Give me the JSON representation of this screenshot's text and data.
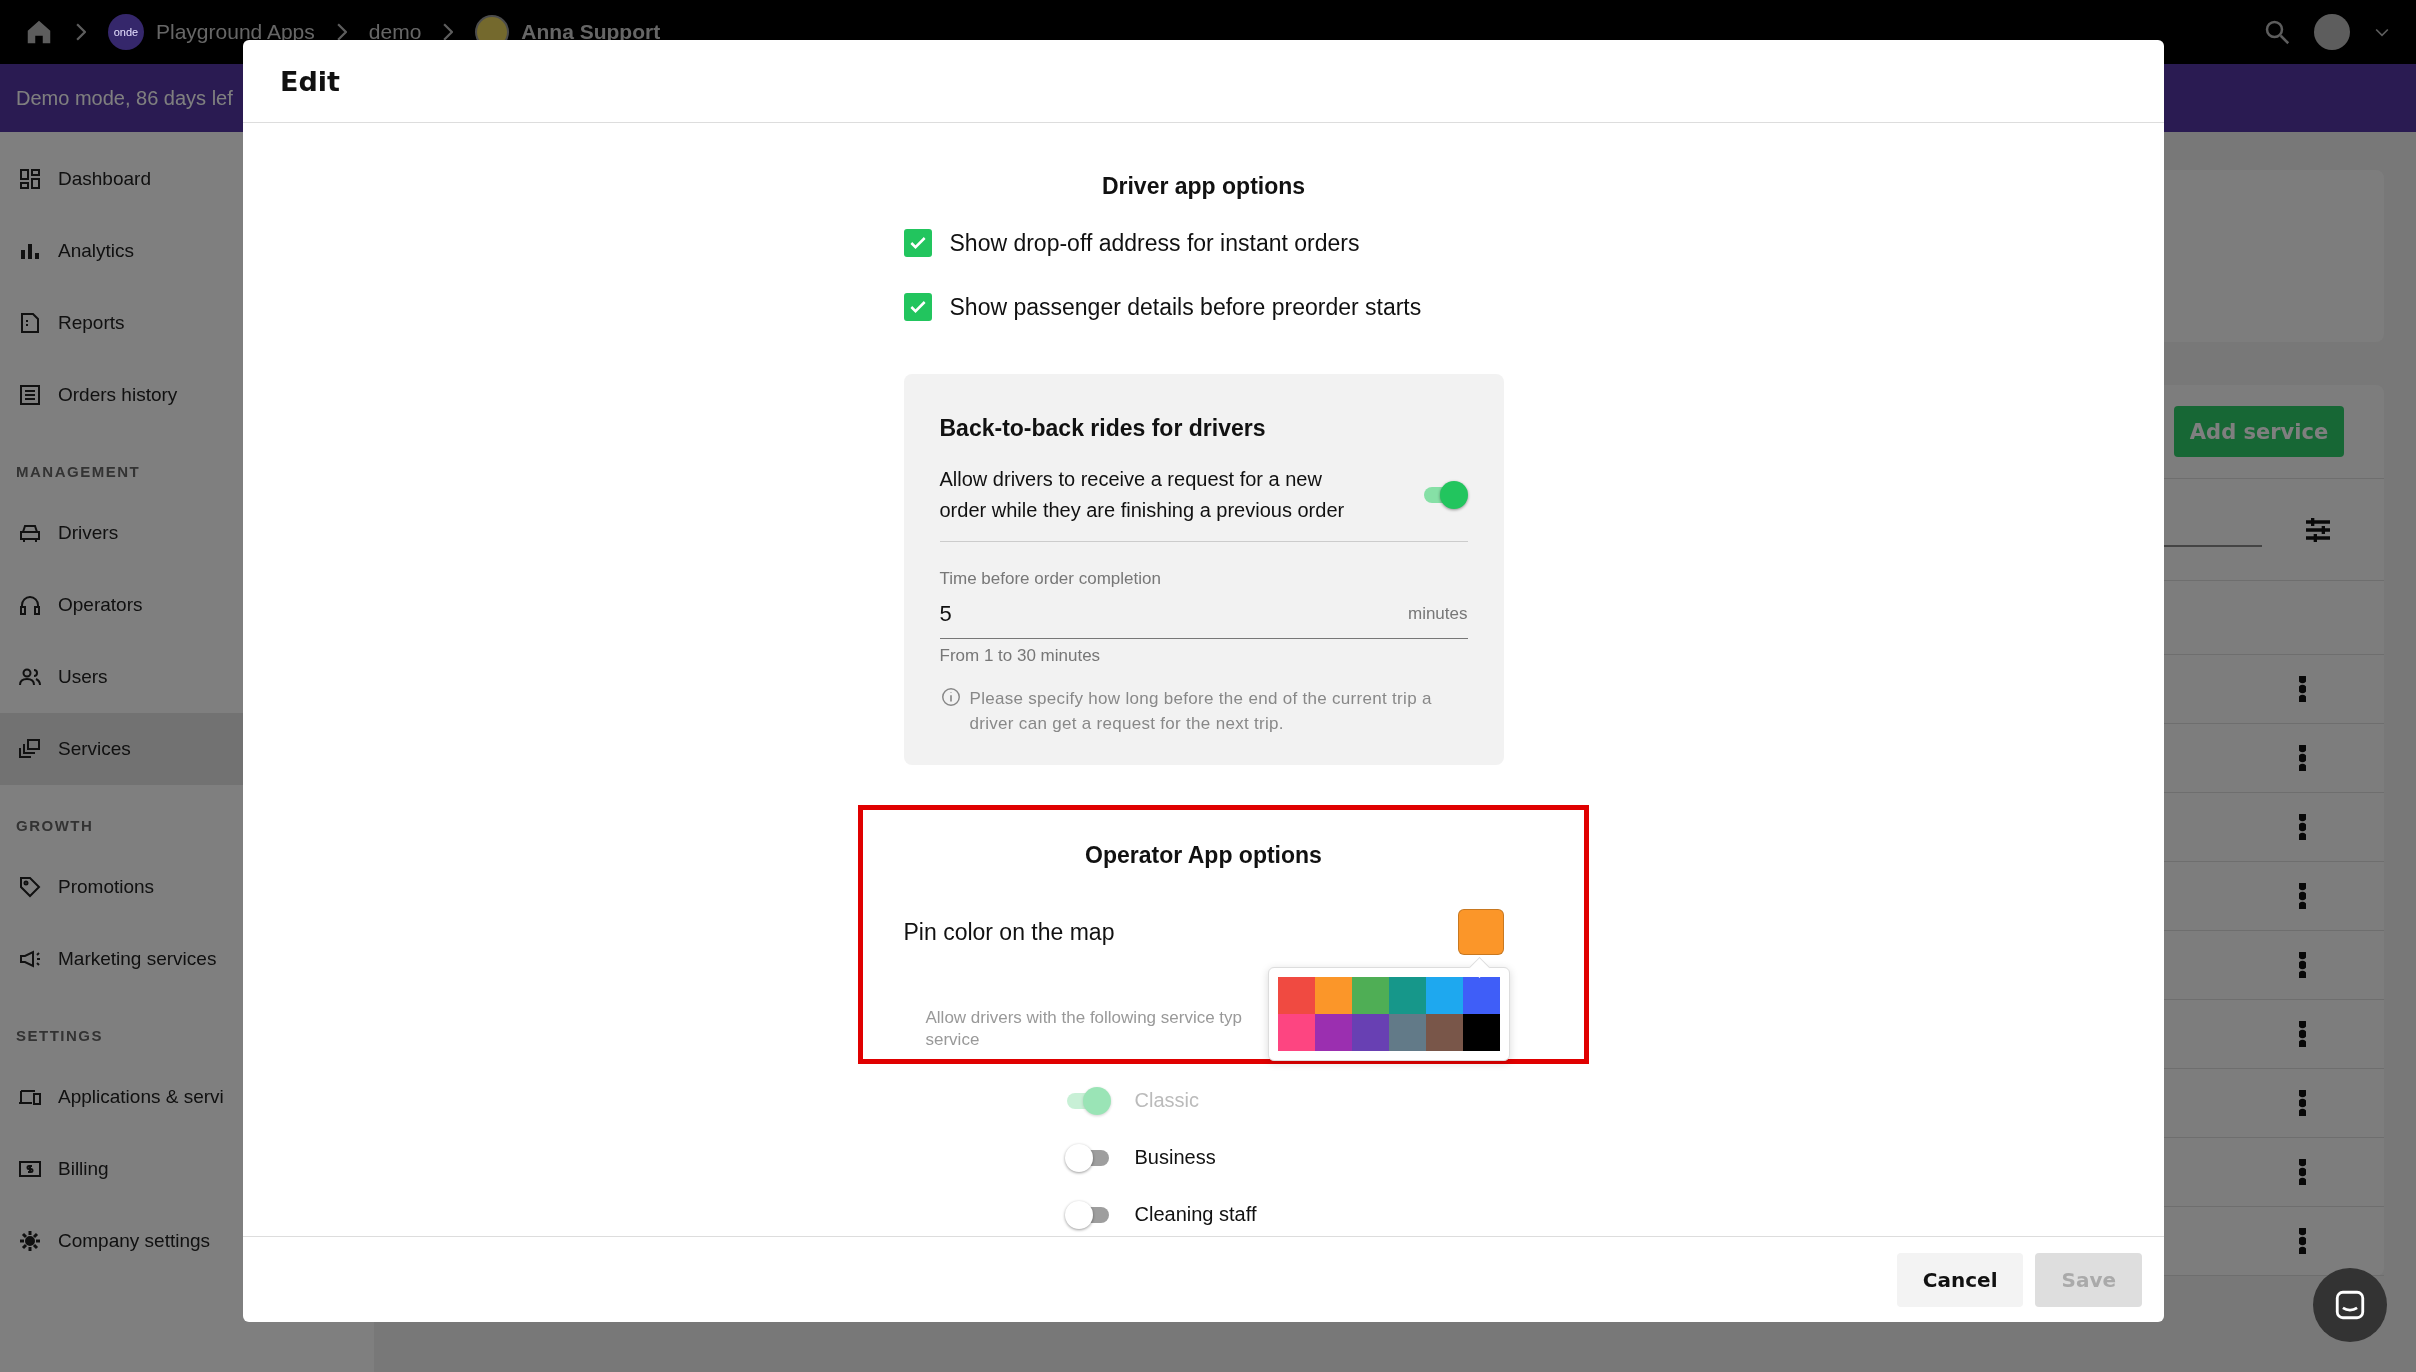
{
  "topbar": {
    "logo": "onde",
    "breadcrumbs": [
      {
        "label": "Playground Apps"
      },
      {
        "label": "demo"
      },
      {
        "label": "Anna Support"
      }
    ]
  },
  "banner": {
    "text": "Demo mode, 86 days lef"
  },
  "sidebar": {
    "sections": [
      {
        "items": [
          {
            "label": "Dashboard",
            "selected": false
          },
          {
            "label": "Analytics",
            "selected": false
          },
          {
            "label": "Reports",
            "selected": false
          },
          {
            "label": "Orders history",
            "selected": false
          }
        ]
      },
      {
        "title": "MANAGEMENT",
        "items": [
          {
            "label": "Drivers",
            "selected": false
          },
          {
            "label": "Operators",
            "selected": false
          },
          {
            "label": "Users",
            "selected": false
          },
          {
            "label": "Services",
            "selected": true
          }
        ]
      },
      {
        "title": "GROWTH",
        "items": [
          {
            "label": "Promotions",
            "selected": false
          },
          {
            "label": "Marketing services",
            "selected": false
          }
        ]
      },
      {
        "title": "SETTINGS",
        "items": [
          {
            "label": "Applications & servi",
            "selected": false
          },
          {
            "label": "Billing",
            "selected": false
          },
          {
            "label": "Company settings",
            "selected": false
          }
        ]
      }
    ]
  },
  "services_page": {
    "add_button": "Add service"
  },
  "modal": {
    "title": "Edit",
    "driver_options": {
      "title": "Driver app options",
      "checkboxes": [
        {
          "label": "Show drop-off address for instant orders",
          "checked": true
        },
        {
          "label": "Show passenger details before preorder starts",
          "checked": true
        }
      ]
    },
    "back_to_back": {
      "title": "Back-to-back rides for drivers",
      "toggle": {
        "label": "Allow drivers to receive a request for a new order while they are finishing a previous order",
        "on": true
      },
      "field": {
        "label": "Time before order completion",
        "value": "5",
        "suffix": "minutes",
        "helper": "From 1 to 30 minutes"
      },
      "note": "Please specify how long before the end of the current trip a driver can get a request for the next trip."
    },
    "operator_options": {
      "title": "Operator App options",
      "highlighted": true,
      "pin_color": {
        "label": "Pin color on the map",
        "color": "#fb9629"
      },
      "palette": [
        {
          "color": "#f04a41"
        },
        {
          "color": "#fb9629"
        },
        {
          "color": "#4fae55"
        },
        {
          "color": "#16978a"
        },
        {
          "color": "#1ea8ef"
        },
        {
          "color": "#3f5ef8"
        },
        {
          "color": "#fd4581"
        },
        {
          "color": "#9b2fb0"
        },
        {
          "color": "#6840b3"
        },
        {
          "color": "#627a88"
        },
        {
          "color": "#795649"
        },
        {
          "color": "#000000"
        }
      ],
      "hint": "Allow drivers with the following service typ\nservice"
    },
    "service_types": [
      {
        "label": "Classic",
        "on": true,
        "disabled": true
      },
      {
        "label": "Business",
        "on": false,
        "disabled": false
      },
      {
        "label": "Cleaning staff",
        "on": false,
        "disabled": false
      }
    ],
    "buttons": [
      {
        "label": "Cancel",
        "disabled": false
      },
      {
        "label": "Save",
        "disabled": true
      }
    ]
  }
}
